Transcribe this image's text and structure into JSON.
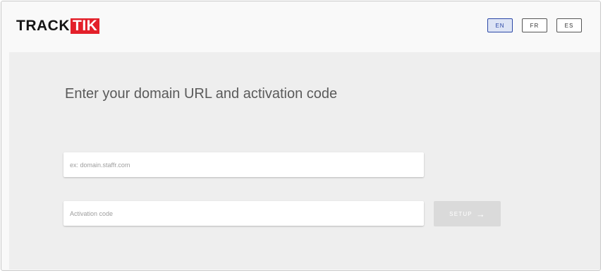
{
  "brand": {
    "logo_part1": "TRACK",
    "logo_part2": "TIK",
    "colors": {
      "logo_red": "#e3202a",
      "logo_dark": "#151515"
    }
  },
  "languages": {
    "items": [
      {
        "label": "EN",
        "active": true
      },
      {
        "label": "FR",
        "active": false
      },
      {
        "label": "ES",
        "active": false
      }
    ],
    "active_color": "#2b47a6"
  },
  "form": {
    "title": "Enter your domain URL and activation code",
    "domain_field": {
      "placeholder": "ex: domain.staffr.com",
      "value": ""
    },
    "code_field": {
      "placeholder": "Activation code",
      "value": ""
    },
    "setup_button": {
      "label": "SETUP",
      "icon": "arrow-right-icon",
      "icon_glyph": "→",
      "enabled": false
    }
  }
}
